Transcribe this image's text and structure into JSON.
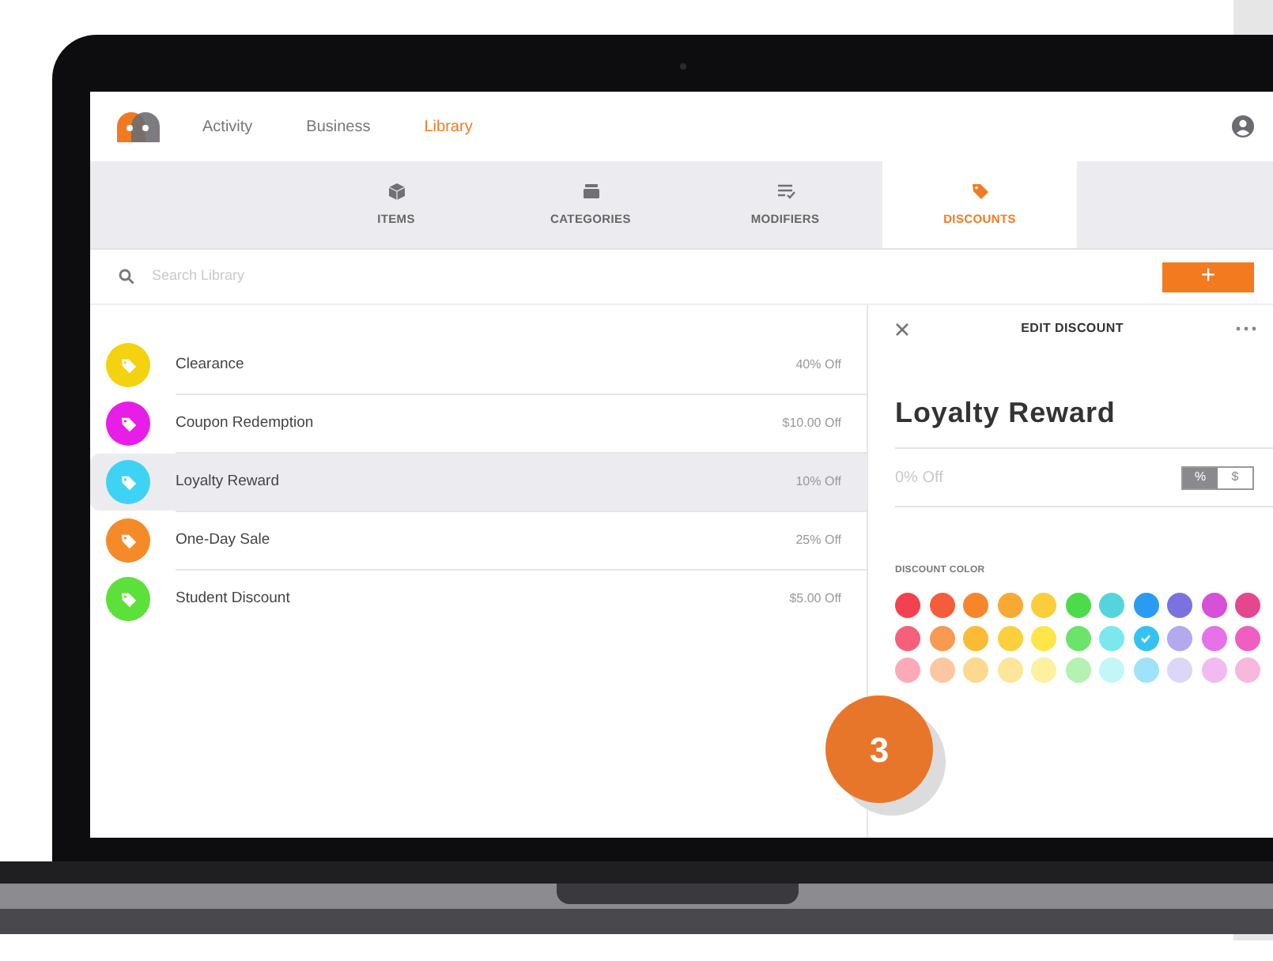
{
  "header": {
    "nav": [
      {
        "label": "Activity",
        "selected": false
      },
      {
        "label": "Business",
        "selected": false
      },
      {
        "label": "Library",
        "selected": true
      }
    ]
  },
  "tabs": [
    {
      "label": "ITEMS",
      "selected": false
    },
    {
      "label": "CATEGORIES",
      "selected": false
    },
    {
      "label": "MODIFIERS",
      "selected": false
    },
    {
      "label": "DISCOUNTS",
      "selected": true
    }
  ],
  "search": {
    "placeholder": "Search Library"
  },
  "add_button": {
    "label": "+"
  },
  "discounts": [
    {
      "name": "Clearance",
      "amount": "40% Off",
      "color": "#f5d20f",
      "selected": false
    },
    {
      "name": "Coupon Redemption",
      "amount": "$10.00 Off",
      "color": "#e81de8",
      "selected": false
    },
    {
      "name": "Loyalty Reward",
      "amount": "10% Off",
      "color": "#3ed3f5",
      "selected": true
    },
    {
      "name": "One-Day Sale",
      "amount": "25% Off",
      "color": "#f58a28",
      "selected": false
    },
    {
      "name": "Student Discount",
      "amount": "$5.00 Off",
      "color": "#5ce03a",
      "selected": false
    }
  ],
  "edit_panel": {
    "title": "EDIT DISCOUNT",
    "name": "Loyalty Reward",
    "amount_placeholder": "0% Off",
    "unit_toggle": [
      {
        "label": "%",
        "selected": true
      },
      {
        "label": "$",
        "selected": false
      }
    ],
    "color_label": "DISCOUNT COLOR",
    "palette_rows": [
      {
        "swatches": [
          {
            "color": "#f5404f",
            "selected": false
          },
          {
            "color": "#f55d3a",
            "selected": false
          },
          {
            "color": "#f7862a",
            "selected": false
          },
          {
            "color": "#f8a834",
            "selected": false
          },
          {
            "color": "#fbcd3a",
            "selected": false
          },
          {
            "color": "#4ddb4b",
            "selected": false
          },
          {
            "color": "#55d4dc",
            "selected": false
          },
          {
            "color": "#2a9bf0",
            "selected": false
          },
          {
            "color": "#7b72e0",
            "selected": false
          },
          {
            "color": "#d84fd8",
            "selected": false
          },
          {
            "color": "#e5478e",
            "selected": false
          }
        ]
      },
      {
        "swatches": [
          {
            "color": "#f6607a",
            "selected": false
          },
          {
            "color": "#f89a52",
            "selected": false
          },
          {
            "color": "#fbbb33",
            "selected": false
          },
          {
            "color": "#fcd03c",
            "selected": false
          },
          {
            "color": "#fde64a",
            "selected": false
          },
          {
            "color": "#6ce46a",
            "selected": false
          },
          {
            "color": "#7be8ee",
            "selected": false
          },
          {
            "color": "#35c2f2",
            "selected": true
          },
          {
            "color": "#b3a9ef",
            "selected": false
          },
          {
            "color": "#e671e8",
            "selected": false
          },
          {
            "color": "#ef5fc0",
            "selected": false
          }
        ]
      },
      {
        "swatches": [
          {
            "color": "#fdaab8",
            "selected": false
          },
          {
            "color": "#fcc6a3",
            "selected": false
          },
          {
            "color": "#fdd98e",
            "selected": false
          },
          {
            "color": "#fde59a",
            "selected": false
          },
          {
            "color": "#fdf09f",
            "selected": false
          },
          {
            "color": "#b3f2b0",
            "selected": false
          },
          {
            "color": "#c2f6f8",
            "selected": false
          },
          {
            "color": "#9fe3f8",
            "selected": false
          },
          {
            "color": "#dcd6f7",
            "selected": false
          },
          {
            "color": "#f2baf1",
            "selected": false
          },
          {
            "color": "#f7b8de",
            "selected": false
          }
        ]
      }
    ]
  },
  "step_badge": "3"
}
